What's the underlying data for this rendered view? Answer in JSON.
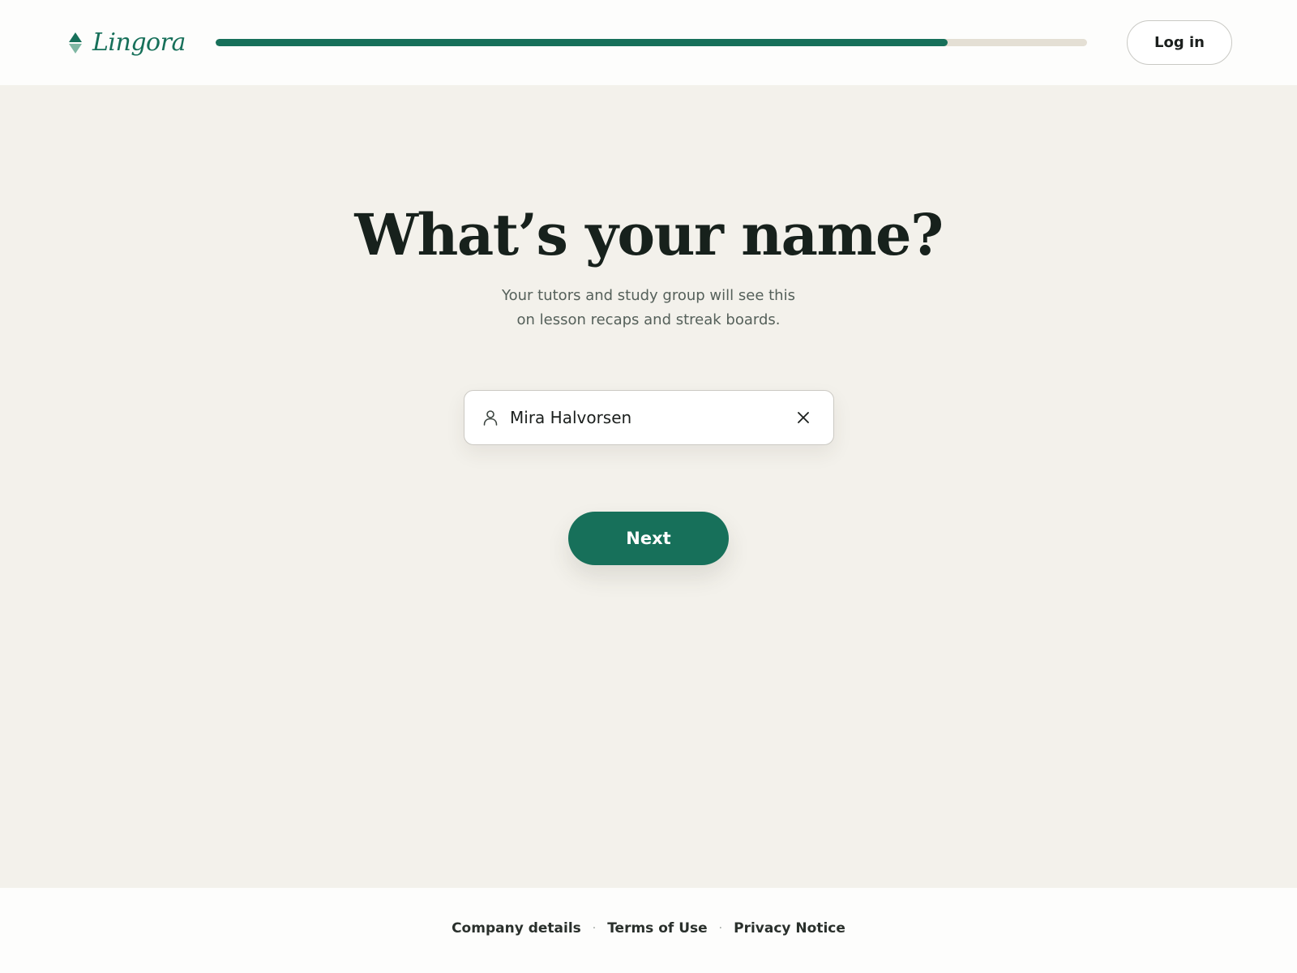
{
  "header": {
    "brand_name": "Lingora",
    "progress_fraction": 0.84,
    "login_label": "Log in"
  },
  "main": {
    "title": "What’s your name?",
    "subtitle_line1": "Your tutors and study group will see this",
    "subtitle_line2": "on lesson recaps and streak boards.",
    "name_field": {
      "value": "Mira Halvorsen",
      "icon": "user-icon",
      "clear_icon": "close-icon"
    },
    "next_label": "Next"
  },
  "footer": {
    "links": [
      "Company details",
      "Terms of Use",
      "Privacy Notice"
    ],
    "separator": "·"
  },
  "colors": {
    "brand": "#17705a",
    "background": "#f3f1eb",
    "progress_track": "#e4dfd4"
  }
}
